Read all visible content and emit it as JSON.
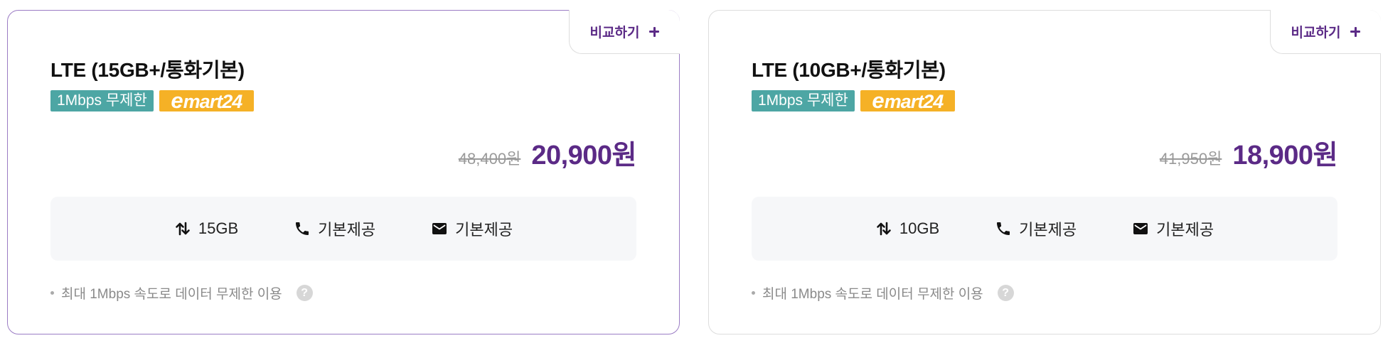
{
  "plans": [
    {
      "compare_label": "비교하기",
      "title": "LTE (15GB+/통화기본)",
      "speed_badge": "1Mbps 무제한",
      "partner_logo_text": "emart24",
      "original_price": "48,400원",
      "sale_price": "20,900원",
      "features": {
        "data": "15GB",
        "call": "기본제공",
        "sms": "기본제공"
      },
      "note": "최대 1Mbps 속도로 데이터 무제한 이용",
      "help_icon_text": "?"
    },
    {
      "compare_label": "비교하기",
      "title": "LTE (10GB+/통화기본)",
      "speed_badge": "1Mbps 무제한",
      "partner_logo_text": "emart24",
      "original_price": "41,950원",
      "sale_price": "18,900원",
      "features": {
        "data": "10GB",
        "call": "기본제공",
        "sms": "기본제공"
      },
      "note": "최대 1Mbps 속도로 데이터 무제한 이용",
      "help_icon_text": "?"
    }
  ],
  "colors": {
    "brand_purple": "#5b2a86",
    "speed_badge_teal": "#4da6a4",
    "emart_yellow": "#f5b126",
    "active_border": "#9b7cc4"
  },
  "icons": {
    "data": "data-transfer-arrows-icon",
    "call": "phone-icon",
    "sms": "envelope-icon",
    "compare": "plus-icon",
    "help": "question-icon"
  }
}
